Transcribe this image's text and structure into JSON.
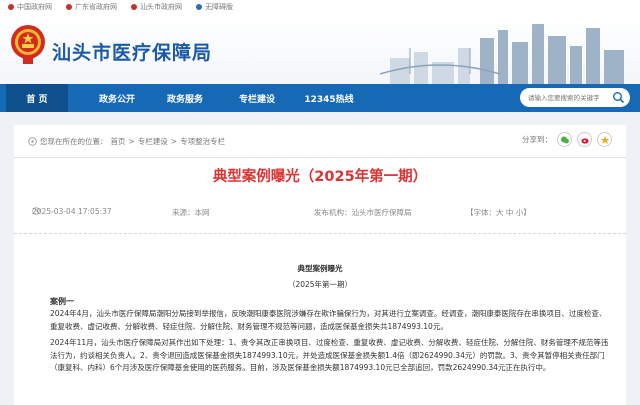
{
  "top_links": [
    "中国政府网",
    "广东省政府网",
    "汕头市政府网",
    "无障碍版"
  ],
  "site_title": "汕头市医疗保障局",
  "nav": {
    "items": [
      "首 页",
      "政务公开",
      "政务服务",
      "专栏建设",
      "12345热线"
    ],
    "active": 0
  },
  "search": {
    "placeholder": "请输入您要搜索的关键字"
  },
  "breadcrumb": {
    "prefix": "您现在所在的位置：",
    "items": [
      "首页",
      "专栏建设",
      "专项整治专栏"
    ],
    "separator": ">"
  },
  "share": {
    "label": "分享到："
  },
  "article": {
    "title": "典型案例曝光（2025年第一期）",
    "date": "2025-03-04 17:05:37",
    "source": "来源：本网",
    "publisher": "发布机构：汕头市医疗保障局",
    "font_size": "【字体：大 中 小】",
    "heading": "典型案例曝光",
    "subheading": "（2025年第一期）",
    "case_label": "案例一",
    "paragraphs": [
      "2024年4月，汕头市医疗保障局潮阳分局接到举报信，反映潮阳康泰医院涉嫌存在欺诈骗保行为，对其进行立案调查。经调查，潮阳康泰医院存在串换项目、过度检查、重复收费、虚记收费、分解收费、轻症住院、分解住院、财务管理不规范等问题，造成医保基金损失共1874993.10元。",
      "2024年11月，汕头市医疗保障局对其作出如下处理：1、责令其改正串换项目、过度检查、重复收费、虚记收费、分解收费、轻症住院、分解住院、财务管理不规范等违法行为，约谈相关负责人。2、责令退回造成医保基金损失1874993.10元，并处造成医保基金损失额1.4倍（即2624990.34元）的罚款。3、责令其暂停相关责任部门（康复科、内科）6个月涉及医疗保障基金使用的医药服务。目前，涉及医保基金损失额1874993.10元已全部追回，罚款2624990.34元正在执行中。"
    ]
  },
  "colors": {
    "nav_bg": "#1669b4",
    "nav_active": "#0e4f8e",
    "title_red": "#dd3333",
    "brand_blue": "#1a5aa8"
  }
}
